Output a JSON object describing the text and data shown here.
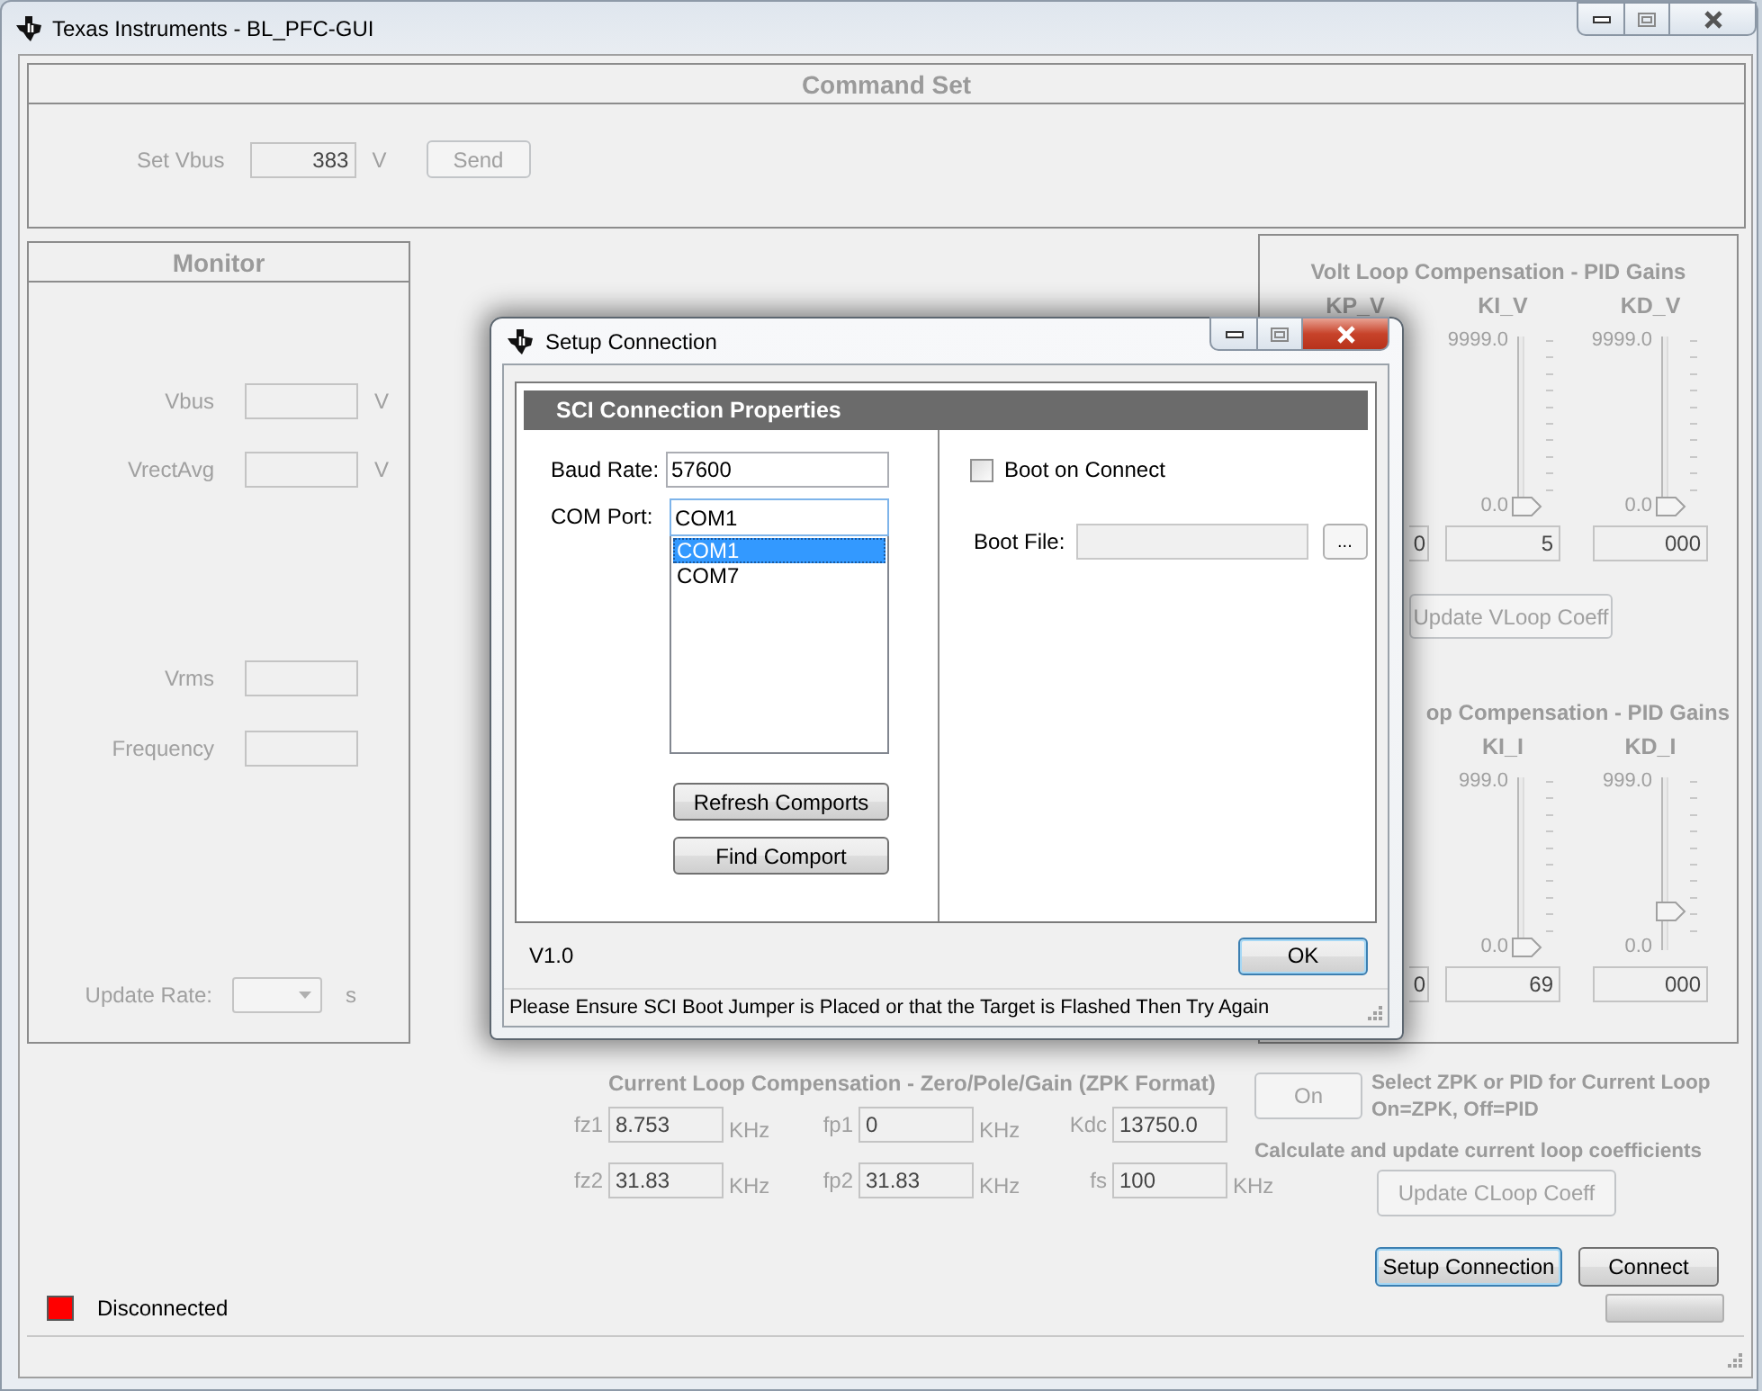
{
  "window": {
    "title": "Texas Instruments - BL_PFC-GUI"
  },
  "command_set": {
    "title": "Command Set",
    "set_vbus": {
      "label": "Set Vbus",
      "value": "383",
      "unit": "V"
    },
    "send_button": {
      "label": "Send",
      "disabled": true
    }
  },
  "monitor": {
    "title": "Monitor",
    "rows": [
      {
        "label": "Vbus",
        "unit": "V"
      },
      {
        "label": "VrectAvg",
        "unit": "V"
      },
      {
        "label": "Vrms"
      },
      {
        "label": "Frequency"
      }
    ],
    "update_rate": {
      "label": "Update Rate:",
      "unit": "s"
    }
  },
  "volt_loop": {
    "title": "Volt Loop Compensation - PID Gains",
    "gains": [
      {
        "label": "KP_V",
        "value": "0"
      },
      {
        "label": "KI_V",
        "max": "9999.0",
        "min": "0.0",
        "level": 0,
        "value": "5"
      },
      {
        "label": "KD_V",
        "max": "9999.0",
        "min": "0.0",
        "level": 0,
        "value": "000"
      }
    ],
    "update_button": {
      "label": "Update VLoop Coeff",
      "disabled": true
    }
  },
  "current_loop_pid": {
    "title": "op Compensation - PID Gains",
    "gains": [
      {
        "value": "0"
      },
      {
        "label": "KI_I",
        "max": "999.0",
        "min": "0.0",
        "level": 0,
        "value": "69"
      },
      {
        "label": "KD_I",
        "max": "999.0",
        "min": "0.0",
        "level": 0.22,
        "value": "000"
      }
    ]
  },
  "zpk": {
    "title": "Current Loop Compensation - Zero/Pole/Gain (ZPK Format)",
    "fields": [
      {
        "label": "fz1",
        "value": "8.753",
        "unit": "KHz"
      },
      {
        "label": "fp1",
        "value": "0",
        "unit": "KHz"
      },
      {
        "label": "Kdc",
        "value": "13750.0"
      },
      {
        "label": "fz2",
        "value": "31.83",
        "unit": "KHz"
      },
      {
        "label": "fp2",
        "value": "31.83",
        "unit": "KHz"
      },
      {
        "label": "fs",
        "value": "100",
        "unit": "KHz"
      }
    ]
  },
  "mode": {
    "button": {
      "label": "On",
      "disabled": true
    },
    "hint": "Select ZPK or PID for Current Loop",
    "legend": "On=ZPK, Off=PID"
  },
  "calculate": {
    "text": "Calculate and update current loop coefficients",
    "button": {
      "label": "Update CLoop Coeff",
      "disabled": true
    }
  },
  "actions": [
    {
      "label": "Setup Connection",
      "focused": true
    },
    {
      "label": "Connect",
      "focused": false
    }
  ],
  "status": {
    "text": "Disconnected",
    "color": "#ff0000"
  },
  "dialog": {
    "title": "Setup Connection",
    "group_title": "SCI Connection Properties",
    "baud_rate": {
      "label": "Baud Rate:",
      "value": "57600"
    },
    "com_port": {
      "label": "COM Port:",
      "value": "COM1",
      "options": [
        {
          "label": "COM1",
          "selected": true
        },
        {
          "label": "COM7",
          "selected": false
        }
      ]
    },
    "buttons": [
      {
        "label": "Refresh Comports"
      },
      {
        "label": "Find Comport"
      }
    ],
    "boot_on_connect": {
      "label": "Boot on Connect",
      "checked": false
    },
    "boot_file": {
      "label": "Boot File:",
      "disabled": true
    },
    "browse_button": "...",
    "version": "V1.0",
    "ok_button": {
      "label": "OK",
      "focused": true
    },
    "status_message": "Please Ensure SCI Boot Jumper is Placed or that the Target is Flashed Then Try Again"
  }
}
